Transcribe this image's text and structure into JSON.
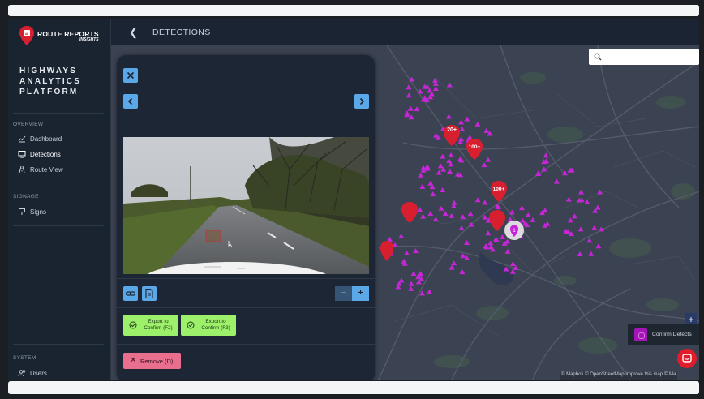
{
  "brand": {
    "name": "ROUTE REPORTS",
    "tagline": "INSIGHTS"
  },
  "platform_title": [
    "HIGHWAYS",
    "ANALYTICS",
    "PLATFORM"
  ],
  "sidebar": {
    "overview_label": "OVERVIEW",
    "items": [
      {
        "label": "Dashboard",
        "icon": "chart-icon"
      },
      {
        "label": "Detections",
        "icon": "monitor-icon"
      },
      {
        "label": "Route View",
        "icon": "route-icon"
      }
    ],
    "signage_label": "SIGNAGE",
    "signage_items": [
      {
        "label": "Signs",
        "icon": "sign-icon"
      }
    ],
    "system_label": "SYSTEM",
    "system_items": [
      {
        "label": "Users",
        "icon": "users-icon"
      }
    ]
  },
  "header": {
    "title": "DETECTIONS"
  },
  "panel": {
    "export_f2": [
      "Export to",
      "Confirm (F2)"
    ],
    "export_f3": [
      "Export to",
      "Confirm (F3)"
    ],
    "remove_label": "Remove (D)"
  },
  "map": {
    "search_placeholder": "",
    "cluster_labels": [
      "20+",
      "100+",
      "100+",
      "1"
    ],
    "legend_label": "Confirm Defects",
    "attribution": "© Mapbox © OpenStreetMap Improve this map © Ma"
  },
  "colors": {
    "accent": "#5ba8e8",
    "marker": "#c726d8",
    "cluster": "#d81f30",
    "export": "#9cf06a",
    "remove": "#ea6f8f"
  }
}
